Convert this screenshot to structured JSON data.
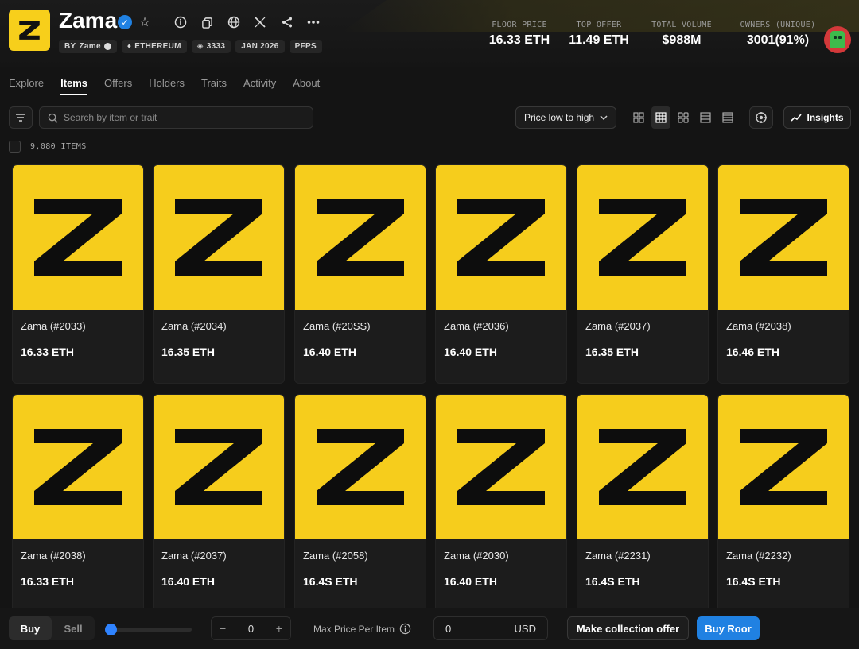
{
  "collection": {
    "name": "Zama",
    "tags": {
      "creator_prefix": "BY",
      "creator": "Zame",
      "chain": "ETHEREUM",
      "supply": "3333",
      "date": "JAN 2026",
      "category": "PFPS"
    }
  },
  "stats": [
    {
      "label": "FLOOR PRICE",
      "value": "16.33 ETH"
    },
    {
      "label": "TOP OFFER",
      "value": "11.49 ETH"
    },
    {
      "label": "TOTAL VOLUME",
      "value": "$988M"
    },
    {
      "label": "OWNERS (UNIQUE)",
      "value": "3001(91%)"
    }
  ],
  "tabs": [
    "Explore",
    "Items",
    "Offers",
    "Holders",
    "Traits",
    "Activity",
    "About"
  ],
  "active_tab": "Items",
  "search": {
    "placeholder": "Search by item or trait",
    "value": ""
  },
  "sort": {
    "selected": "Price low to high"
  },
  "insights_label": "Insights",
  "item_count": "9,080 ITEMS",
  "items": [
    {
      "name": "Zama (#2033)",
      "price": "16.33 ETH"
    },
    {
      "name": "Zama (#2034)",
      "price": "16.35 ETH"
    },
    {
      "name": "Zama (#20SS)",
      "price": "16.40 ETH"
    },
    {
      "name": "Zama (#2036)",
      "price": "16.40 ETH"
    },
    {
      "name": "Zama (#2037)",
      "price": "16.35 ETH"
    },
    {
      "name": "Zama (#2038)",
      "price": "16.46 ETH"
    },
    {
      "name": "Zama (#2038)",
      "price": "16.33 ETH"
    },
    {
      "name": "Zama (#2037)",
      "price": "16.40 ETH"
    },
    {
      "name": "Zama (#2058)",
      "price": "16.4S ETH"
    },
    {
      "name": "Zama (#2030)",
      "price": "16.40 ETH"
    },
    {
      "name": "Zama (#2231)",
      "price": "16.4S ETH"
    },
    {
      "name": "Zama (#2232)",
      "price": "16.4S ETH"
    }
  ],
  "footer": {
    "buy_label": "Buy",
    "sell_label": "Sell",
    "slider_fraction": 0.06,
    "quantity": "0",
    "max_price_label": "Max Price Per Item",
    "price_value": "0",
    "currency": "USD",
    "offer_button": "Make collection offer",
    "buy_button": "Buy Roor"
  },
  "colors": {
    "brand_yellow": "#f6cd1c",
    "accent_blue": "#2081e2",
    "background": "#141414"
  }
}
